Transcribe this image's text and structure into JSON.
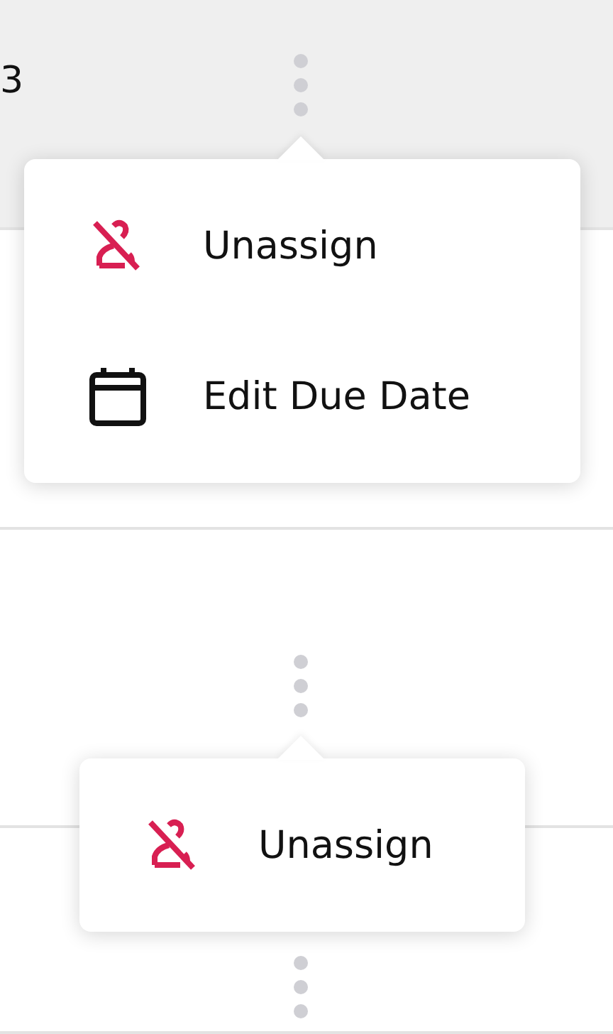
{
  "rows": [
    {
      "label": "3",
      "selected": true,
      "menu": [
        {
          "kind": "unassign",
          "label": "Unassign"
        },
        {
          "kind": "due-date",
          "label": "Edit Due Date"
        }
      ]
    },
    {
      "selected": false
    },
    {
      "selected": false,
      "menu": [
        {
          "kind": "unassign",
          "label": "Unassign"
        }
      ]
    },
    {
      "selected": false
    }
  ]
}
